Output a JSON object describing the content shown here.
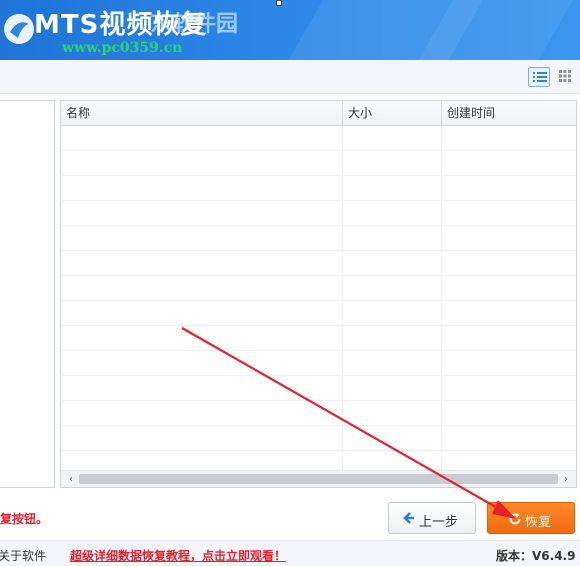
{
  "titlebar": {
    "app_title": "MTS视频恢复",
    "watermark_name": "东软件园",
    "watermark_url": "www.pc0359.cn"
  },
  "toolbar": {
    "list_view_icon": "list-view-icon",
    "grid_view_icon": "grid-view-icon"
  },
  "table": {
    "columns": [
      "名称",
      "大小",
      "创建时间"
    ],
    "rows": []
  },
  "footer": {
    "hint": "复按钮。",
    "back_label": "上一步",
    "recover_label": "恢复"
  },
  "statusbar": {
    "about": "关于软件",
    "tutorial": "超级详细数据恢复教程，点击立即观看！",
    "version": "版本：V6.4.9"
  },
  "colors": {
    "titlebar": "#2b86e6",
    "recover_button": "#f36a0d",
    "annotation_arrow": "#e8202c"
  }
}
